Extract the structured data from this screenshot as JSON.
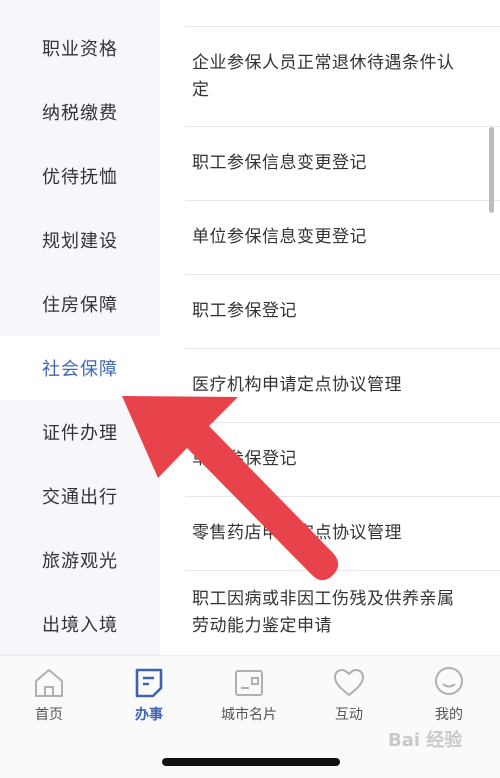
{
  "sidebar": {
    "items": [
      {
        "label": "职业资格"
      },
      {
        "label": "纳税缴费"
      },
      {
        "label": "优待抚恤"
      },
      {
        "label": "规划建设"
      },
      {
        "label": "住房保障"
      },
      {
        "label": "社会保障",
        "active": true
      },
      {
        "label": "证件办理"
      },
      {
        "label": "交通出行"
      },
      {
        "label": "旅游观光"
      },
      {
        "label": "出境入境"
      }
    ]
  },
  "services": {
    "items": [
      {
        "label": "企业参保人员正常退休待遇条件认定"
      },
      {
        "label": "职工参保信息变更登记"
      },
      {
        "label": "单位参保信息变更登记"
      },
      {
        "label": "职工参保登记"
      },
      {
        "label": "医疗机构申请定点协议管理"
      },
      {
        "label": "单位参保登记"
      },
      {
        "label": "零售药店申请定点协议管理"
      },
      {
        "label": "职工因病或非因工伤残及供养亲属劳动能力鉴定申请"
      }
    ]
  },
  "tabbar": {
    "tabs": [
      {
        "label": "首页",
        "icon": "home-icon"
      },
      {
        "label": "办事",
        "icon": "document-icon",
        "active": true
      },
      {
        "label": "城市名片",
        "icon": "card-icon"
      },
      {
        "label": "互动",
        "icon": "heart-icon"
      },
      {
        "label": "我的",
        "icon": "smile-icon"
      }
    ]
  },
  "watermark": {
    "text": "Bai 经验"
  },
  "colors": {
    "accent": "#4367b7",
    "annotation_arrow": "#e8434a",
    "sidebar_bg": "#f5f7fb"
  }
}
